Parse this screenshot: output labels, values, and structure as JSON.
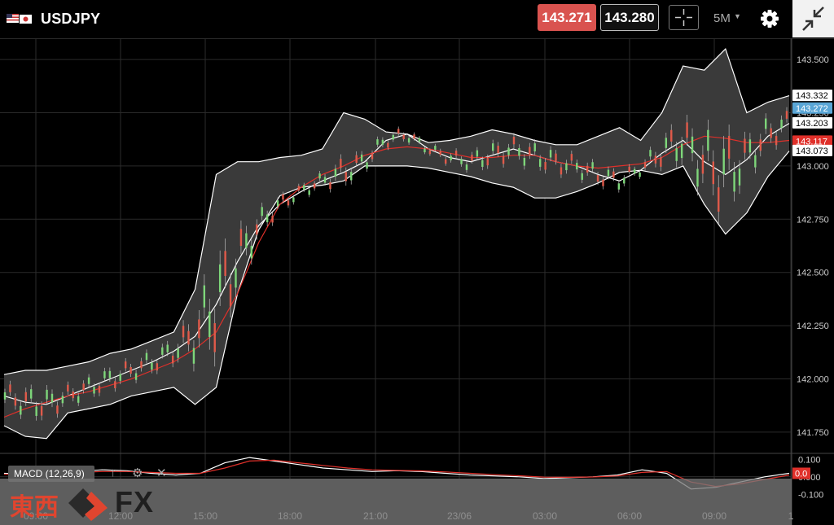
{
  "header": {
    "symbol": "USDJPY",
    "sell_price": "143.271",
    "buy_price": "143.280",
    "timeframe": "5M",
    "colors": {
      "sell": "#d9534f",
      "buy_border": "#bbbbbb",
      "background": "#000000"
    },
    "icons": [
      "flags-us-jp-icon",
      "crosshair-icon",
      "dropdown-caret-icon",
      "gear-icon",
      "collapse-arrows-icon"
    ]
  },
  "chart_data": [
    {
      "type": "candlestick",
      "title": "",
      "symbol": "USDJPY",
      "timeframe": "5M",
      "indicators": [
        "Bollinger Bands",
        "Moving Average (red)"
      ],
      "ylim": [
        141.65,
        143.6
      ],
      "y_ticks": [
        "143.500",
        "143.250",
        "143.000",
        "142.750",
        "142.500",
        "142.250",
        "142.000",
        "141.750"
      ],
      "x_ticks": [
        "09:00",
        "12:00",
        "15:00",
        "18:00",
        "21:00",
        "23/06",
        "03:00",
        "06:00",
        "09:00",
        "1"
      ],
      "price_tags": [
        {
          "label": "143.332",
          "value": 143.332,
          "color": "#ffffff"
        },
        {
          "label": "143.272",
          "value": 143.272,
          "color": "#5aa6d6"
        },
        {
          "label": "143.203",
          "value": 143.203,
          "color": "#ffffff"
        },
        {
          "label": "143.117",
          "value": 143.117,
          "color": "#e0302a"
        },
        {
          "label": "143.073",
          "value": 143.073,
          "color": "#ffffff"
        }
      ],
      "series": [
        {
          "name": "Middle band",
          "values": [
            141.92,
            141.89,
            141.88,
            141.92,
            141.96,
            142.0,
            142.04,
            142.08,
            142.13,
            142.2,
            142.35,
            142.55,
            142.72,
            142.82,
            142.88,
            142.93,
            142.97,
            143.02,
            143.12,
            143.15,
            143.08,
            143.04,
            143.02,
            143.05,
            143.08,
            143.05,
            143.02,
            143.0,
            142.96,
            142.93,
            142.98,
            143.06,
            143.12,
            143.02,
            142.96,
            143.03,
            143.14,
            143.2
          ]
        },
        {
          "name": "Upper band",
          "values": [
            142.02,
            142.04,
            142.04,
            142.06,
            142.08,
            142.12,
            142.14,
            142.18,
            142.22,
            142.42,
            142.96,
            143.02,
            143.02,
            143.04,
            143.05,
            143.08,
            143.25,
            143.22,
            143.16,
            143.15,
            143.11,
            143.12,
            143.14,
            143.17,
            143.15,
            143.12,
            143.1,
            143.1,
            143.14,
            143.18,
            143.12,
            143.25,
            143.47,
            143.45,
            143.55,
            143.25,
            143.3,
            143.33
          ]
        },
        {
          "name": "Lower band",
          "values": [
            141.78,
            141.73,
            141.72,
            141.84,
            141.86,
            141.88,
            141.92,
            141.94,
            141.96,
            141.88,
            141.96,
            142.4,
            142.7,
            142.86,
            142.9,
            142.91,
            142.93,
            143.0,
            143.0,
            143.0,
            142.99,
            142.97,
            142.95,
            142.92,
            142.9,
            142.85,
            142.85,
            142.88,
            142.92,
            142.97,
            142.98,
            142.96,
            143.0,
            142.82,
            142.68,
            142.78,
            142.95,
            143.07
          ]
        },
        {
          "name": "Moving average",
          "values": [
            141.82,
            141.86,
            141.89,
            141.92,
            141.94,
            141.97,
            142.0,
            142.04,
            142.08,
            142.14,
            142.22,
            142.4,
            142.64,
            142.82,
            142.9,
            142.96,
            143.0,
            143.05,
            143.08,
            143.09,
            143.08,
            143.06,
            143.04,
            143.04,
            143.05,
            143.05,
            143.02,
            143.0,
            142.99,
            143.0,
            143.01,
            143.04,
            143.1,
            143.14,
            143.13,
            143.11,
            143.11,
            143.12
          ]
        }
      ]
    },
    {
      "type": "line",
      "title": "MACD (12,26,9)",
      "ylim": [
        -0.15,
        0.12
      ],
      "y_ticks": [
        "0.100",
        "0.000",
        "-0.100"
      ],
      "last_value_tag": "0.0",
      "series": [
        {
          "name": "MACD",
          "values": [
            0.02,
            0.015,
            0.02,
            0.03,
            0.04,
            0.035,
            0.02,
            0.01,
            0.02,
            0.08,
            0.11,
            0.09,
            0.07,
            0.05,
            0.04,
            0.03,
            0.035,
            0.03,
            0.02,
            0.01,
            0.005,
            0.0,
            -0.01,
            -0.005,
            0.0,
            0.01,
            0.04,
            0.02,
            -0.07,
            -0.06,
            -0.03,
            0.0,
            0.02
          ]
        },
        {
          "name": "Signal",
          "values": [
            0.015,
            0.015,
            0.018,
            0.025,
            0.03,
            0.03,
            0.025,
            0.02,
            0.02,
            0.05,
            0.09,
            0.095,
            0.08,
            0.065,
            0.05,
            0.04,
            0.036,
            0.034,
            0.028,
            0.02,
            0.012,
            0.006,
            -0.002,
            -0.003,
            -0.001,
            0.005,
            0.025,
            0.03,
            -0.03,
            -0.055,
            -0.04,
            -0.015,
            0.01
          ]
        }
      ]
    }
  ],
  "macd_panel": {
    "label": "MACD (12,26,9)"
  },
  "watermark": {
    "kanji": "東西",
    "fx": "FX"
  }
}
